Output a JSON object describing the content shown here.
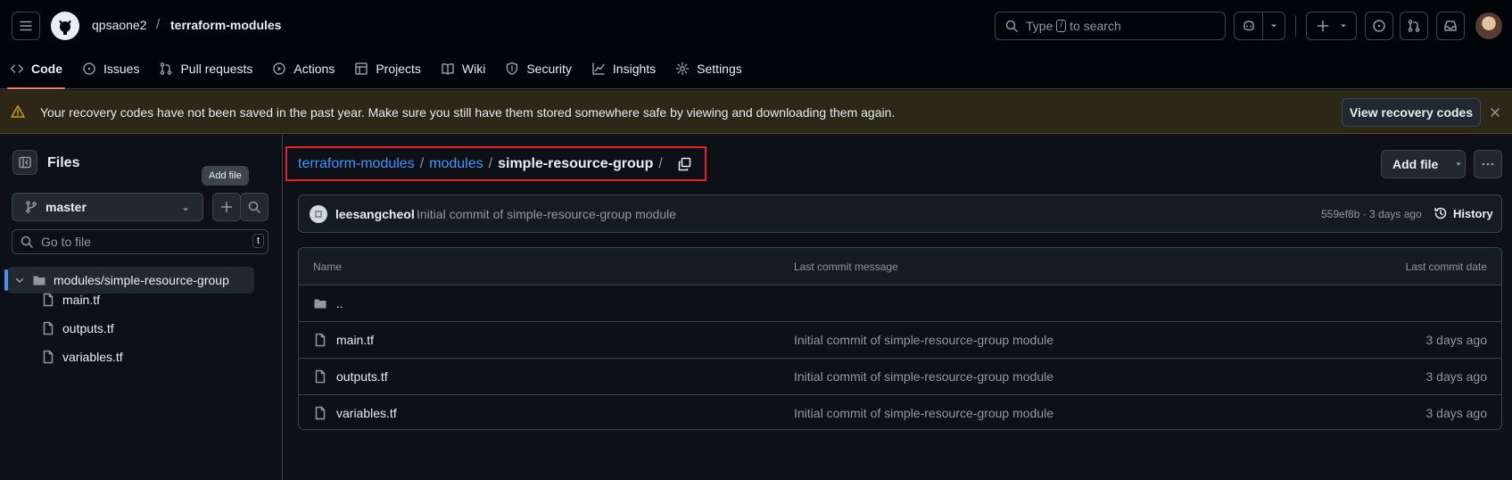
{
  "header": {
    "owner": "qpsaone2",
    "separator": "/",
    "repo": "terraform-modules",
    "search_prefix": "Type",
    "search_kbd": "/",
    "search_suffix": "to search"
  },
  "tabs": [
    {
      "label": "Code",
      "icon": "code-icon",
      "active": true
    },
    {
      "label": "Issues",
      "icon": "issue-icon"
    },
    {
      "label": "Pull requests",
      "icon": "pull-request-icon"
    },
    {
      "label": "Actions",
      "icon": "play-icon"
    },
    {
      "label": "Projects",
      "icon": "table-icon"
    },
    {
      "label": "Wiki",
      "icon": "book-icon"
    },
    {
      "label": "Security",
      "icon": "shield-icon"
    },
    {
      "label": "Insights",
      "icon": "graph-icon"
    },
    {
      "label": "Settings",
      "icon": "gear-icon"
    }
  ],
  "banner": {
    "message": "Your recovery codes have not been saved in the past year. Make sure you still have them stored somewhere safe by viewing and downloading them again.",
    "button": "View recovery codes"
  },
  "sidebar": {
    "title": "Files",
    "tooltip": "Add file",
    "branch": "master",
    "goto_placeholder": "Go to file",
    "goto_kbd": "t",
    "tree": {
      "folder": "modules/simple-resource-group",
      "files": [
        "main.tf",
        "outputs.tf",
        "variables.tf"
      ]
    }
  },
  "breadcrumb": {
    "root": "terraform-modules",
    "sep": "/",
    "middle": "modules",
    "current": "simple-resource-group",
    "trailing": "/"
  },
  "actions": {
    "add_file": "Add file"
  },
  "commit": {
    "author": "leesangcheol",
    "message": "Initial commit of simple-resource-group module",
    "meta": "559ef8b · 3 days ago",
    "history": "History"
  },
  "file_table": {
    "headers": {
      "name": "Name",
      "message": "Last commit message",
      "date": "Last commit date"
    },
    "parent": "..",
    "rows": [
      {
        "name": "main.tf",
        "message": "Initial commit of simple-resource-group module",
        "date": "3 days ago"
      },
      {
        "name": "outputs.tf",
        "message": "Initial commit of simple-resource-group module",
        "date": "3 days ago"
      },
      {
        "name": "variables.tf",
        "message": "Initial commit of simple-resource-group module",
        "date": "3 days ago"
      }
    ]
  },
  "colors": {
    "accent": "#4493f8",
    "tab_underline": "#f78166",
    "highlight_box": "#e5242a",
    "banner_bg": "#2c2716"
  }
}
